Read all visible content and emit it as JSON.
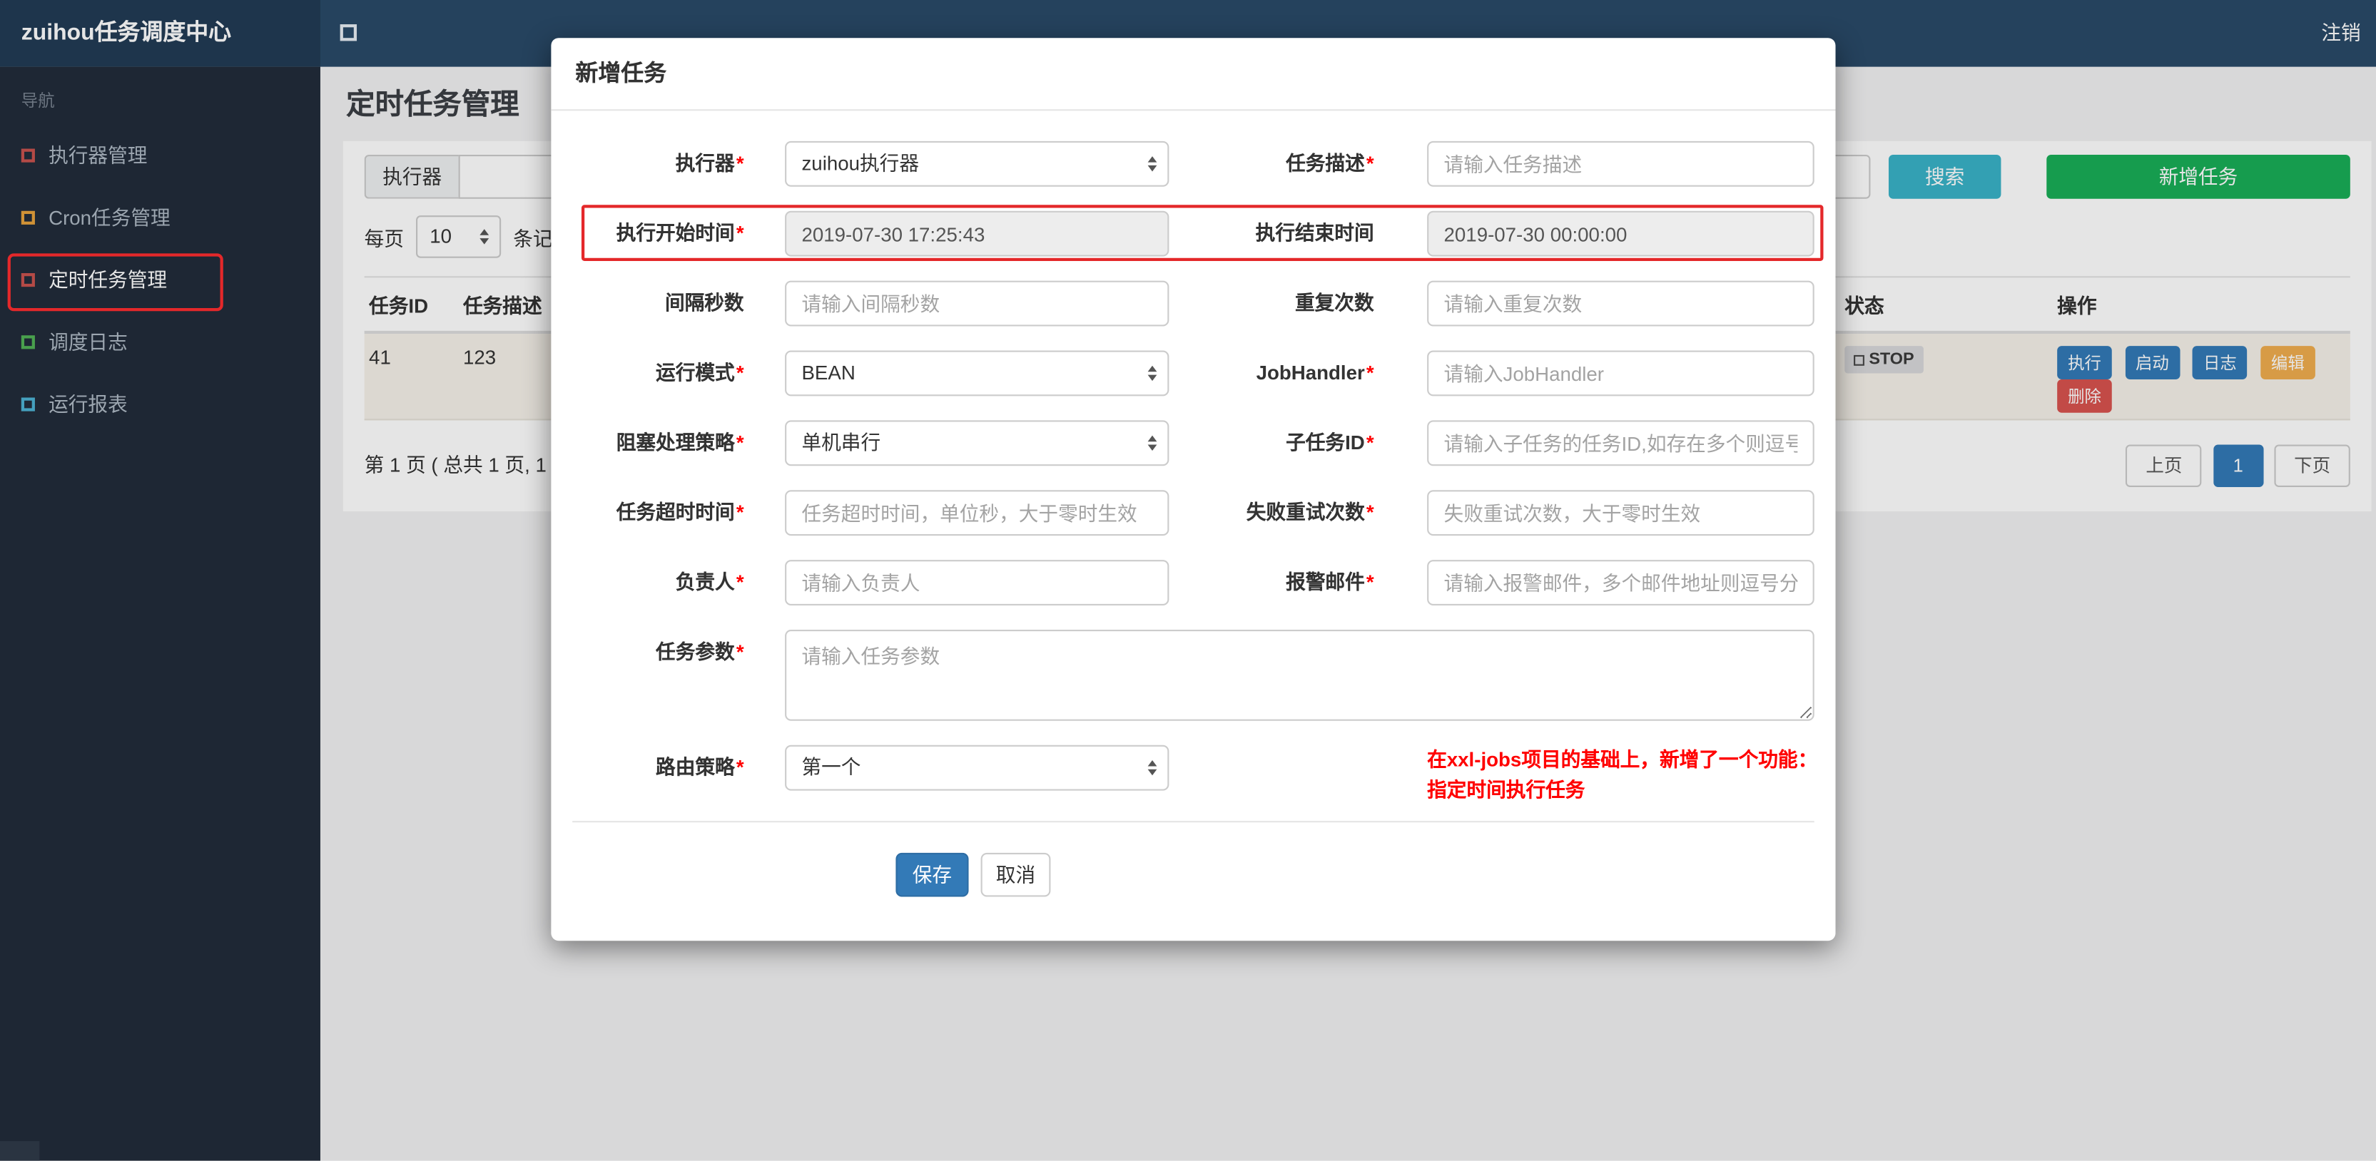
{
  "glyphs": {
    "required_mark": "*"
  },
  "navbar": {
    "brand": "zuihou任务调度中心",
    "logout_label": "注销"
  },
  "sidebar": {
    "section_label": "导航",
    "items": [
      {
        "label": "执行器管理",
        "icon_color": "#c9534e",
        "active": false
      },
      {
        "label": "Cron任务管理",
        "icon_color": "#e8a33d",
        "active": false
      },
      {
        "label": "定时任务管理",
        "icon_color": "#c9534e",
        "active": true
      },
      {
        "label": "调度日志",
        "icon_color": "#52b356",
        "active": false
      },
      {
        "label": "运行报表",
        "icon_color": "#4db3d4",
        "active": false
      }
    ]
  },
  "page": {
    "title": "定时任务管理",
    "filter": {
      "executor_label": "执行器",
      "search_button": "搜索",
      "add_button": "新增任务"
    },
    "page_size": {
      "prefix": "每页",
      "value": "10",
      "suffix": "条记录"
    },
    "table": {
      "headers": {
        "id": "任务ID",
        "desc": "任务描述",
        "status": "状态",
        "actions": "操作"
      },
      "row": {
        "id": "41",
        "desc": "123",
        "status": "STOP",
        "actions": {
          "run": "执行",
          "start": "启动",
          "log": "日志",
          "edit": "编辑",
          "del": "删除"
        }
      }
    },
    "pagination": {
      "summary": "第 1 页 ( 总共 1 页, 1",
      "prev": "上页",
      "current": "1",
      "next": "下页"
    }
  },
  "modal": {
    "title": "新增任务",
    "rows": [
      {
        "left": {
          "label": "执行器",
          "required": true,
          "type": "select",
          "value": "zuihou执行器"
        },
        "right": {
          "label": "任务描述",
          "required": true,
          "type": "input",
          "placeholder": "请输入任务描述"
        }
      },
      {
        "left": {
          "label": "执行开始时间",
          "required": true,
          "type": "readonly",
          "value": "2019-07-30 17:25:43"
        },
        "right": {
          "label": "执行结束时间",
          "required": false,
          "type": "readonly",
          "value": "2019-07-30 00:00:00"
        },
        "highlighted": true
      },
      {
        "left": {
          "label": "间隔秒数",
          "required": false,
          "type": "input",
          "placeholder": "请输入间隔秒数"
        },
        "right": {
          "label": "重复次数",
          "required": false,
          "type": "input",
          "placeholder": "请输入重复次数"
        }
      },
      {
        "left": {
          "label": "运行模式",
          "required": true,
          "type": "select",
          "value": "BEAN"
        },
        "right": {
          "label": "JobHandler",
          "required": true,
          "type": "input",
          "placeholder": "请输入JobHandler"
        }
      },
      {
        "left": {
          "label": "阻塞处理策略",
          "required": true,
          "type": "select",
          "value": "单机串行"
        },
        "right": {
          "label": "子任务ID",
          "required": true,
          "type": "input",
          "placeholder": "请输入子任务的任务ID,如存在多个则逗号分隔"
        }
      },
      {
        "left": {
          "label": "任务超时时间",
          "required": true,
          "type": "input",
          "placeholder": "任务超时时间，单位秒，大于零时生效"
        },
        "right": {
          "label": "失败重试次数",
          "required": true,
          "type": "input",
          "placeholder": "失败重试次数，大于零时生效"
        }
      },
      {
        "left": {
          "label": "负责人",
          "required": true,
          "type": "input",
          "placeholder": "请输入负责人"
        },
        "right": {
          "label": "报警邮件",
          "required": true,
          "type": "input",
          "placeholder": "请输入报警邮件，多个邮件地址则逗号分隔"
        }
      }
    ],
    "param_row": {
      "label": "任务参数",
      "required": true,
      "placeholder": "请输入任务参数"
    },
    "route_row": {
      "label": "路由策略",
      "required": true,
      "value": "第一个"
    },
    "note": {
      "line1": "在xxl-jobs项目的基础上，新增了一个功能：",
      "line2": "指定时间执行任务"
    },
    "buttons": {
      "save": "保存",
      "cancel": "取消"
    }
  },
  "colors": {
    "annotation": "#e4282a",
    "note_text": "#ff0000",
    "search_button": "#39b3c8",
    "add_button": "#19ae57",
    "primary": "#337ab7",
    "warning": "#f0ad4e",
    "danger": "#d9534f",
    "stop_badge_bg": "#d9d9db"
  }
}
